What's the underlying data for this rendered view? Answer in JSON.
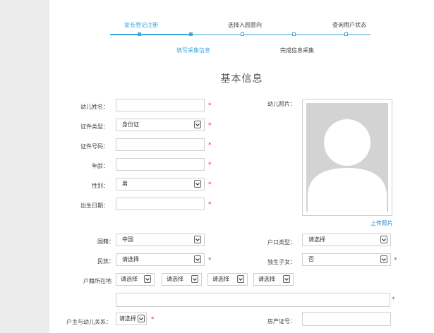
{
  "steps": [
    {
      "label": "家长登记注册",
      "active": true
    },
    {
      "label": "填写采集信息",
      "active": true
    },
    {
      "label": "选择入园意向",
      "active": false
    },
    {
      "label": "完成信息采集",
      "active": false
    },
    {
      "label": "查询用户状态",
      "active": false
    }
  ],
  "section_title": "基本信息",
  "form": {
    "child_name_label": "幼儿姓名：",
    "id_type_label": "证件类型：",
    "id_type_value": "身份证",
    "id_number_label": "证件号码：",
    "age_label": "年龄：",
    "gender_label": "性别：",
    "gender_value": "男",
    "birth_date_label": "出生日期：",
    "photo_label": "幼儿照片：",
    "upload_photo": "上传照片",
    "nationality_label": "国籍：",
    "nationality_value": "中国",
    "hukou_type_label": "户口类型：",
    "hukou_type_value": "请选择",
    "ethnicity_label": "民族：",
    "ethnicity_value": "请选择",
    "only_child_label": "独生子女：",
    "only_child_value": "否",
    "hukou_location_label": "户籍所在地",
    "hukou_selects": [
      "请选择",
      "请选择",
      "请选择",
      "请选择"
    ],
    "relation_label": "户主与幼儿关系：",
    "relation_value": "请选择",
    "property_cert_label": "房产证号：",
    "required_mark": "*"
  },
  "colors": {
    "accent": "#3ea7df",
    "required": "#e23030",
    "link": "#2f86c9"
  }
}
